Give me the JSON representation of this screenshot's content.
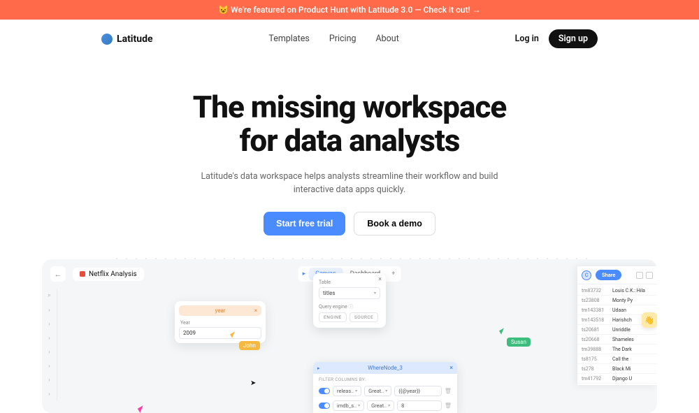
{
  "banner": {
    "text": "😺 We're featured on Product Hunt with Latitude 3.0 — Check it out! →"
  },
  "brand": "Latitude",
  "nav": {
    "templates": "Templates",
    "pricing": "Pricing",
    "about": "About"
  },
  "actions": {
    "login": "Log in",
    "signup": "Sign up"
  },
  "hero": {
    "title1": "The missing workspace",
    "title2": "for data analysts",
    "sub1": "Latitude's data workspace helps analysts streamline their workflow and build",
    "sub2": "interactive data apps quickly.",
    "primary": "Start free trial",
    "secondary": "Book a demo"
  },
  "product": {
    "back": "←",
    "project": "Netflix Analysis",
    "tabs": {
      "canvas": "Canvas",
      "dashboard": "Dashboard",
      "plus": "+"
    },
    "popover": {
      "tableLabel": "Table",
      "tableValue": "titles",
      "engineLabel": "Query engine",
      "engine": "ENGINE",
      "source": "SOURCE"
    },
    "year": {
      "title": "year",
      "label": "Year",
      "value": "2009"
    },
    "cursors": {
      "john": "John",
      "susan": "Susan"
    },
    "where": {
      "title": "WhereNode_3",
      "sub": "FILTER COLUMNS BY:",
      "rows": [
        {
          "col": "releas..",
          "op": "Great..",
          "val": "{{@year}}"
        },
        {
          "col": "imdb_s..",
          "op": "Great..",
          "val": "8"
        }
      ]
    },
    "share": {
      "avatar": "C",
      "btn": "Share"
    },
    "table": [
      {
        "id": "tm83732",
        "title": "Louis C.K.: Hila"
      },
      {
        "id": "ts23808",
        "title": "Monty Py"
      },
      {
        "id": "tm143381",
        "title": "Udaan"
      },
      {
        "id": "tm143518",
        "title": "Harishch"
      },
      {
        "id": "ts20681",
        "title": "Unriddle"
      },
      {
        "id": "ts20668",
        "title": "Shameles"
      },
      {
        "id": "tm39888",
        "title": "The Dark"
      },
      {
        "id": "ts8175",
        "title": "Call the"
      },
      {
        "id": "ts278",
        "title": "Black Mi"
      },
      {
        "id": "tm41792",
        "title": "Django U"
      }
    ]
  }
}
